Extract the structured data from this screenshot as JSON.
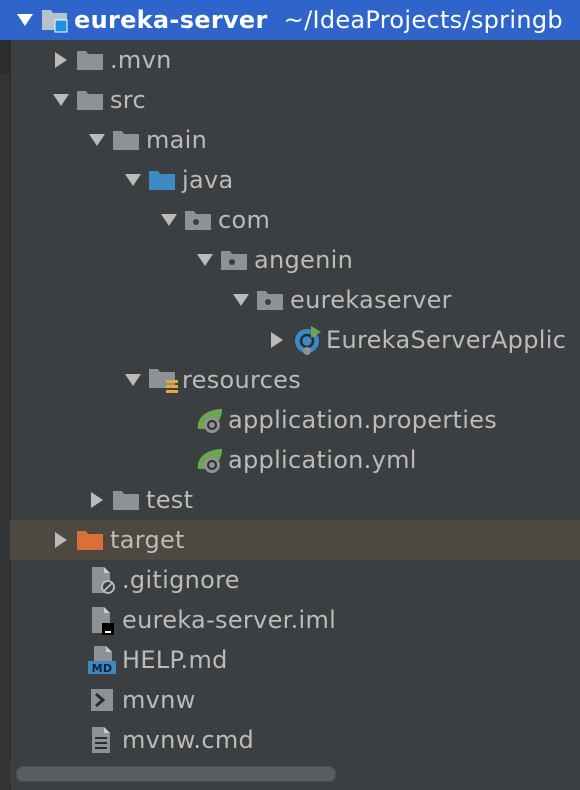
{
  "tree": {
    "root": {
      "project": "eureka-server",
      "path": "~/IdeaProjects/springb"
    },
    "items": {
      "mvn": ".mvn",
      "src": "src",
      "main": "main",
      "java": "java",
      "com": "com",
      "angenin": "angenin",
      "eurekaserver": "eurekaserver",
      "app_class": "EurekaServerApplic",
      "resources": "resources",
      "app_properties": "application.properties",
      "app_yml": "application.yml",
      "test": "test",
      "target": "target",
      "gitignore": ".gitignore",
      "iml": "eureka-server.iml",
      "help": "HELP.md",
      "mvnw": "mvnw",
      "mvnw_cmd": "mvnw.cmd"
    },
    "md_badge": "MD"
  },
  "colors": {
    "selection": "#2f65ca",
    "hover_row": "#4d4840",
    "folder": "#8d9296",
    "source_folder": "#3d89c2",
    "excluded_folder": "#d9703c",
    "spring_green": "#6aa84f",
    "class_blue": "#3d89c2",
    "text": "#bbbbbb"
  }
}
